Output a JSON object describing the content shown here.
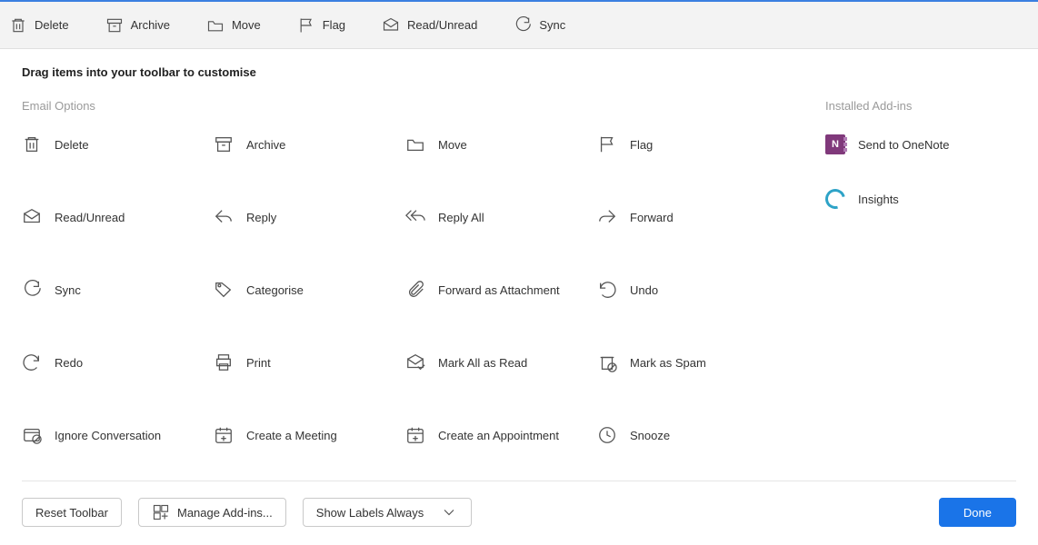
{
  "toolbar": [
    {
      "id": "delete",
      "label": "Delete",
      "icon": "trash"
    },
    {
      "id": "archive",
      "label": "Archive",
      "icon": "archive"
    },
    {
      "id": "move",
      "label": "Move",
      "icon": "folder"
    },
    {
      "id": "flag",
      "label": "Flag",
      "icon": "flag"
    },
    {
      "id": "readun",
      "label": "Read/Unread",
      "icon": "mail"
    },
    {
      "id": "sync",
      "label": "Sync",
      "icon": "sync"
    }
  ],
  "instruction": "Drag items into your toolbar to customise",
  "sections": {
    "email_title": "Email Options",
    "addins_title": "Installed Add-ins"
  },
  "email_options": [
    {
      "id": "delete",
      "label": "Delete",
      "icon": "trash"
    },
    {
      "id": "archive",
      "label": "Archive",
      "icon": "archive"
    },
    {
      "id": "move",
      "label": "Move",
      "icon": "folder"
    },
    {
      "id": "flag",
      "label": "Flag",
      "icon": "flag"
    },
    {
      "id": "readunread",
      "label": "Read/Unread",
      "icon": "mail"
    },
    {
      "id": "reply",
      "label": "Reply",
      "icon": "reply"
    },
    {
      "id": "replyall",
      "label": "Reply All",
      "icon": "replyall"
    },
    {
      "id": "forward",
      "label": "Forward",
      "icon": "forward"
    },
    {
      "id": "sync",
      "label": "Sync",
      "icon": "sync"
    },
    {
      "id": "categorise",
      "label": "Categorise",
      "icon": "tag"
    },
    {
      "id": "fwdattach",
      "label": "Forward as Attachment",
      "icon": "attach"
    },
    {
      "id": "undo",
      "label": "Undo",
      "icon": "undo"
    },
    {
      "id": "redo",
      "label": "Redo",
      "icon": "redo"
    },
    {
      "id": "print",
      "label": "Print",
      "icon": "print"
    },
    {
      "id": "markallread",
      "label": "Mark All as Read",
      "icon": "mailcheck"
    },
    {
      "id": "spam",
      "label": "Mark as Spam",
      "icon": "spam"
    },
    {
      "id": "ignore",
      "label": "Ignore Conversation",
      "icon": "ignore"
    },
    {
      "id": "meeting",
      "label": "Create a Meeting",
      "icon": "calplus"
    },
    {
      "id": "appointment",
      "label": "Create an Appointment",
      "icon": "calplus"
    },
    {
      "id": "snooze",
      "label": "Snooze",
      "icon": "clock"
    }
  ],
  "addins": [
    {
      "id": "onenote",
      "label": "Send to OneNote",
      "icon": "onenote"
    },
    {
      "id": "insights",
      "label": "Insights",
      "icon": "insights"
    }
  ],
  "footer": {
    "reset": "Reset Toolbar",
    "manage": "Manage Add-ins...",
    "show_labels": "Show Labels Always",
    "done": "Done"
  }
}
